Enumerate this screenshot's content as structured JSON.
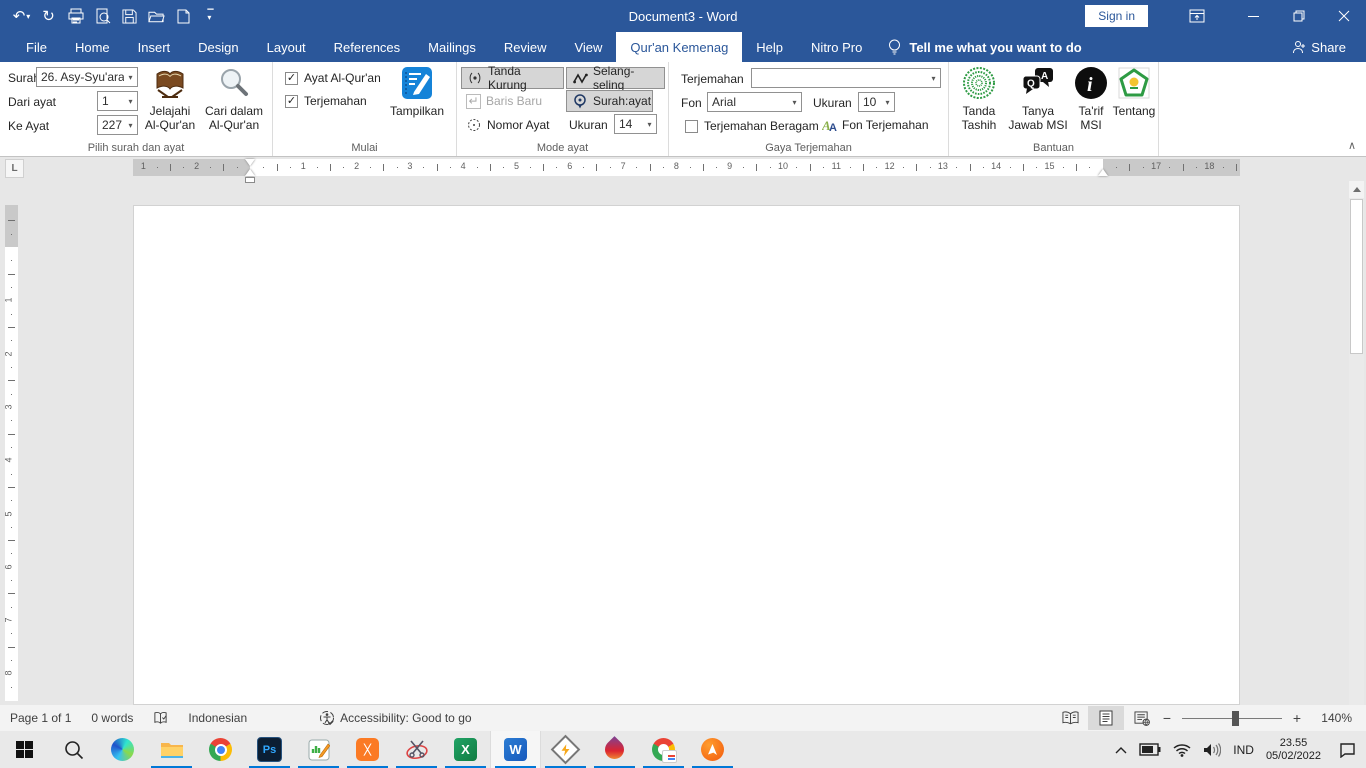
{
  "titlebar": {
    "title": "Document3 - Word",
    "sign_in": "Sign in"
  },
  "tabs": {
    "items": [
      "File",
      "Home",
      "Insert",
      "Design",
      "Layout",
      "References",
      "Mailings",
      "Review",
      "View",
      "Qur'an Kemenag",
      "Help",
      "Nitro Pro"
    ],
    "active": "Qur'an Kemenag",
    "tell_me": "Tell me what you want to do",
    "share": "Share"
  },
  "ribbon": {
    "pilih": {
      "label": "Pilih surah dan ayat",
      "surah_label": "Surah",
      "surah_value": "26. Asy-Syu'ara",
      "dari_label": "Dari ayat",
      "dari_value": "1",
      "ke_label": "Ke Ayat",
      "ke_value": "227",
      "jelajahi_line1": "Jelajahi",
      "jelajahi_line2": "Al-Qur'an",
      "cari_line1": "Cari dalam",
      "cari_line2": "Al-Qur'an"
    },
    "mulai": {
      "label": "Mulai",
      "ayat_checkbox": "Ayat Al-Qur'an",
      "terjemahan_checkbox": "Terjemahan",
      "tampilkan": "Tampilkan"
    },
    "mode": {
      "label": "Mode ayat",
      "tanda_kurung": "Tanda Kurung",
      "selang_seling": "Selang-seling",
      "baris_baru": "Baris Baru",
      "surah_ayat": "Surah:ayat",
      "nomor_ayat": "Nomor Ayat",
      "ukuran_label": "Ukuran",
      "ukuran_value": "14"
    },
    "gaya": {
      "label": "Gaya Terjemahan",
      "terjemahan_label": "Terjemahan",
      "terjemahan_value": "",
      "fon_label": "Fon",
      "fon_value": "Arial",
      "ukuran_label": "Ukuran",
      "ukuran_value": "10",
      "beragam_checkbox": "Terjemahan Beragam",
      "fon_terjemahan": "Fon Terjemahan"
    },
    "bantuan": {
      "label": "Bantuan",
      "tashih_line1": "Tanda",
      "tashih_line2": "Tashih",
      "tanya_line1": "Tanya",
      "tanya_line2": "Jawab MSI",
      "tarif_line1": "Ta'rif",
      "tarif_line2": "MSI",
      "tentang": "Tentang"
    }
  },
  "ruler": {
    "h_left": [
      "2",
      "1"
    ],
    "h_main": [
      "1",
      "2",
      "3",
      "4",
      "5",
      "6",
      "7",
      "8",
      "9",
      "10",
      "11",
      "12",
      "13",
      "14",
      "15"
    ],
    "h_right": [
      "17",
      "18"
    ],
    "v_main": [
      "1",
      "2",
      "3",
      "4",
      "5",
      "6",
      "7",
      "8"
    ]
  },
  "statusbar": {
    "page": "Page 1 of 1",
    "words": "0 words",
    "language": "Indonesian",
    "accessibility": "Accessibility: Good to go",
    "zoom_level": "140%"
  },
  "taskbar": {
    "tray": {
      "lang": "IND",
      "time": "23.55",
      "date": "05/02/2022"
    }
  },
  "icons": {
    "undo": "↶",
    "redo": "↻",
    "dropdown_caret": "▾",
    "small_caret": "▾",
    "check": "✓",
    "return": "↵",
    "collapse": "∧",
    "tab_stop": "L",
    "zoom_out": "−",
    "zoom_in": "+",
    "photoshop": "Ps",
    "excel": "X",
    "word": "W",
    "qa_q": "Q",
    "qa_a": "A",
    "info_i": "i"
  },
  "colors": {
    "titlebar_blue": "#2b579a",
    "accent_blue": "#0078d7",
    "tampilkan_blue": "#1583d8"
  }
}
